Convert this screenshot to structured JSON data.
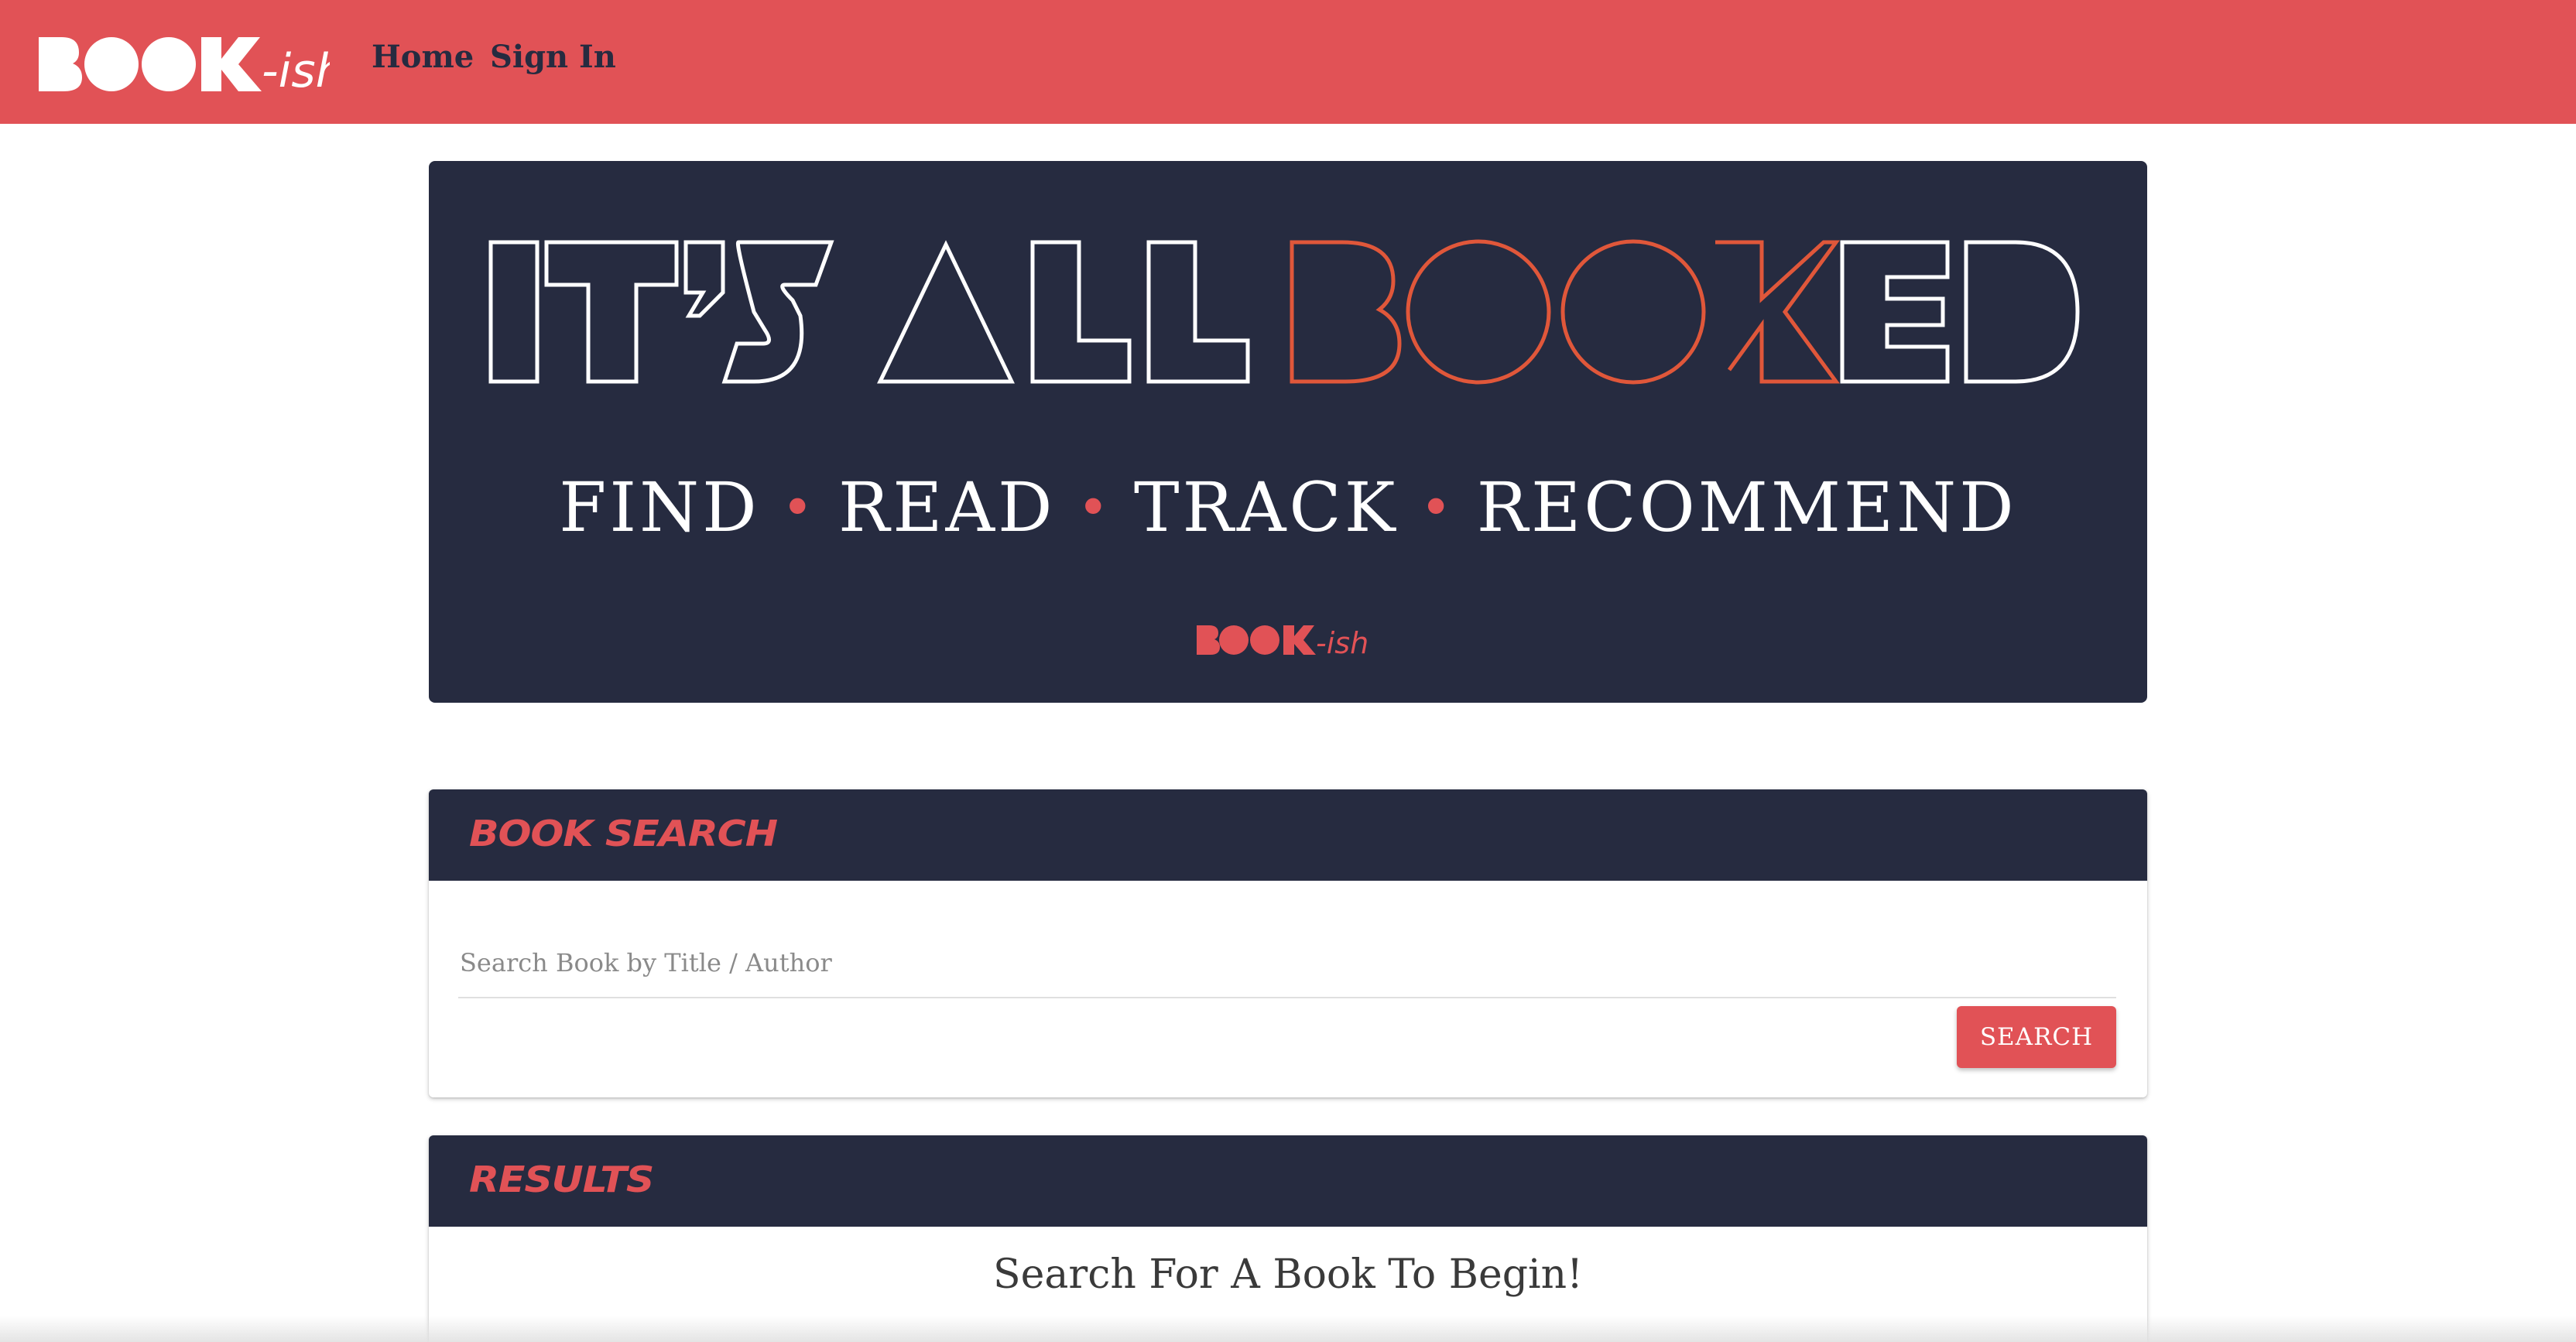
{
  "navbar": {
    "brand": "BOOK-ish",
    "links": [
      "Home",
      "Sign In"
    ]
  },
  "hero": {
    "headline_part1": "IT'S ALL",
    "headline_part2": "BOOKED",
    "tagline_words": [
      "FIND",
      "READ",
      "TRACK",
      "RECOMMEND"
    ],
    "tagline_separator": "•",
    "footer_logo": "BOOK-ish"
  },
  "search": {
    "title": "BOOK SEARCH",
    "placeholder": "Search Book by Title / Author",
    "value": "",
    "button_label": "SEARCH"
  },
  "results": {
    "title": "RESULTS",
    "message": "Search For A Book To Begin!"
  },
  "colors": {
    "accent": "#e15256",
    "dark": "#262b40",
    "headline_orange": "#e0573a"
  }
}
